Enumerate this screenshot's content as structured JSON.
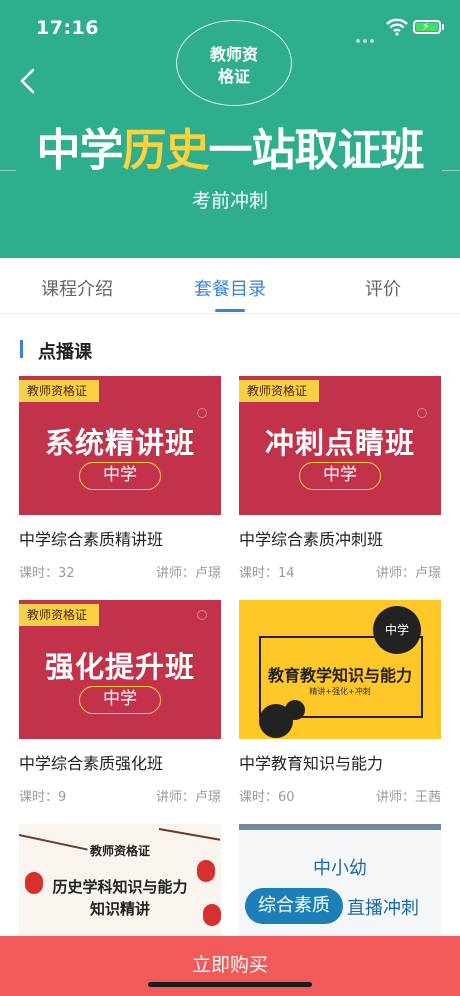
{
  "status_bar": {
    "time": "17:16"
  },
  "hero": {
    "badge": [
      "教师资",
      "格证"
    ],
    "title_pre": "中学",
    "title_highlight": "历史",
    "title_post": "一站取证班",
    "subtitle": "考前冲刺",
    "highlight_color": "#ffd23c",
    "bg_color": "#2eae8c"
  },
  "tabs": [
    {
      "label": "课程介绍",
      "active": false
    },
    {
      "label": "套餐目录",
      "active": true
    },
    {
      "label": "评价",
      "active": false
    }
  ],
  "section": {
    "title": "点播课"
  },
  "courses": [
    {
      "thumb_tag": "教师资格证",
      "thumb_big": "系统精讲班",
      "thumb_pill": "中学",
      "title": "中学综合素质精讲班",
      "lessons": "课时：32",
      "teacher": "讲师：卢璟"
    },
    {
      "thumb_tag": "教师资格证",
      "thumb_big": "冲刺点睛班",
      "thumb_pill": "中学",
      "title": "中学综合素质冲刺班",
      "lessons": "课时：14",
      "teacher": "讲师：卢璟"
    },
    {
      "thumb_tag": "教师资格证",
      "thumb_big": "强化提升班",
      "thumb_pill": "中学",
      "title": "中学综合素质强化班",
      "lessons": "课时：9",
      "teacher": "讲师：卢璟"
    },
    {
      "thumb_dot": "中学",
      "thumb_big": "教育教学知识与能力",
      "thumb_sub": "精讲+强化+冲刺",
      "title": "中学教育知识与能力",
      "lessons": "课时：60",
      "teacher": "讲师：王茜"
    },
    {
      "thumb_tag": "教师资格证",
      "thumb_line1": "历史学科知识与能力",
      "thumb_line2": "知识精讲"
    },
    {
      "thumb_title": "中小幼",
      "thumb_oval": "综合素质",
      "thumb_right": "直播冲刺"
    }
  ],
  "buy_button": {
    "label": "立即购买",
    "color": "#f05a5a"
  },
  "accent_color": "#3a82d6"
}
